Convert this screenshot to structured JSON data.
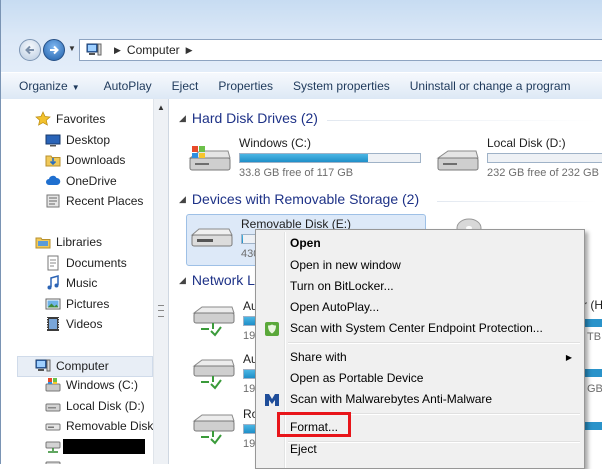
{
  "breadcrumb": {
    "root": "Computer"
  },
  "toolbar": {
    "organize": "Organize",
    "autoplay": "AutoPlay",
    "eject": "Eject",
    "properties": "Properties",
    "system_properties": "System properties",
    "uninstall": "Uninstall or change a program"
  },
  "nav": {
    "favorites": "Favorites",
    "desktop": "Desktop",
    "downloads": "Downloads",
    "onedrive": "OneDrive",
    "recent": "Recent Places",
    "libraries": "Libraries",
    "documents": "Documents",
    "music": "Music",
    "pictures": "Pictures",
    "videos": "Videos",
    "computer": "Computer",
    "windows_c": "Windows (C:)",
    "local_d": "Local Disk (D:)",
    "removable_e": "Removable Disk"
  },
  "groups": {
    "hdd": "Hard Disk Drives (2)",
    "removable": "Devices with Removable Storage (2)",
    "network": "Network L"
  },
  "drives": {
    "c": {
      "name": "Windows (C:)",
      "free": "33.8 GB free of 117 GB",
      "used_fraction": 0.71
    },
    "d": {
      "name": "Local Disk (D:)",
      "free": "232 GB free of 232 GB",
      "used_fraction": 0.0
    },
    "e": {
      "name": "Removable Disk (E:)",
      "free": "430",
      "used_fraction": 0.05
    }
  },
  "network_partial": {
    "n1_name": "Au",
    "n1_size": "19.",
    "n2_name": "Au",
    "n2_size": "19.",
    "n3_name": "Ro",
    "n3_size": "19.",
    "right_h": "r (H",
    "right_tb": "TB",
    "right_gb": "GB"
  },
  "context_menu": {
    "open": "Open",
    "open_new_window": "Open in new window",
    "bitlocker": "Turn on BitLocker...",
    "open_autoplay": "Open AutoPlay...",
    "scan_endpoint": "Scan with System Center Endpoint Protection...",
    "share_with": "Share with",
    "portable": "Open as Portable Device",
    "malwarebytes": "Scan with Malwarebytes Anti-Malware",
    "format": "Format...",
    "eject": "Eject"
  },
  "colors": {
    "accent_red": "#e8151a",
    "group_heading": "#1e3287",
    "bar_fill": "#1f8fc8"
  }
}
